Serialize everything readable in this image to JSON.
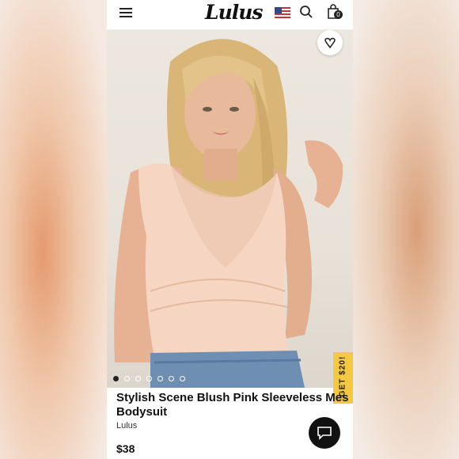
{
  "header": {
    "logo": "Lulus",
    "bag_count": "0"
  },
  "icons": {
    "menu": "hamburger-icon",
    "flag": "us-flag-icon",
    "search": "search-icon",
    "bag": "shopping-bag-icon",
    "favorite": "heart-icon",
    "chat": "chat-icon"
  },
  "carousel": {
    "total_slides": 7,
    "active_index": 0
  },
  "promo": {
    "label": "GET $20!"
  },
  "product": {
    "title_line1": "Stylish Scene Blush Pink Sleeveless Mes",
    "title_line2": "Bodysuit",
    "brand": "Lulus",
    "price": "$38"
  },
  "colors": {
    "promo_bg": "#f5c842",
    "bodysuit": "#f6d6c3",
    "chat_bg": "#111111"
  }
}
